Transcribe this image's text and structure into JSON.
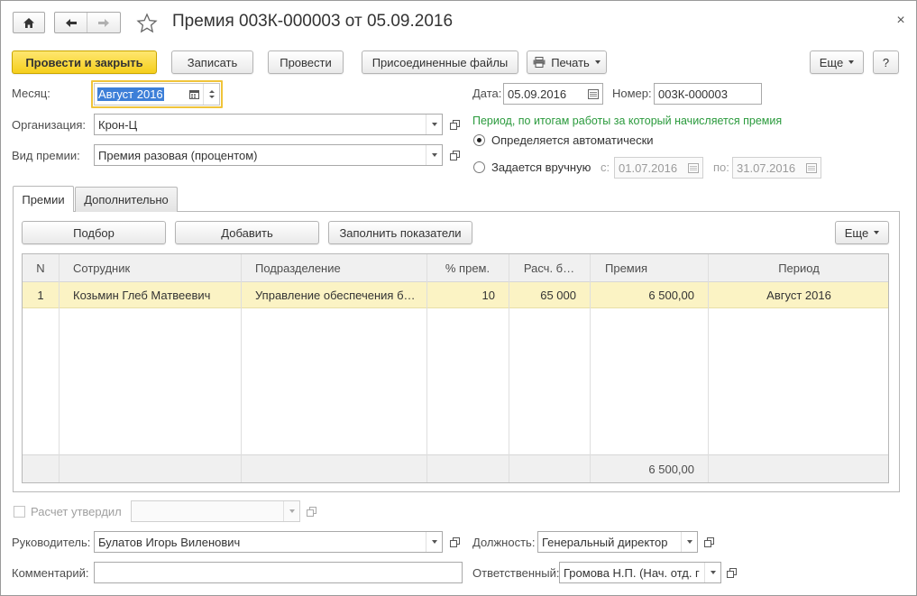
{
  "window": {
    "title": "Премия 003К-000003 от 05.09.2016"
  },
  "toolbar": {
    "post_close": "Провести и закрыть",
    "save": "Записать",
    "post": "Провести",
    "attached_files": "Присоединенные файлы",
    "print": "Печать",
    "more": "Еще",
    "help": "?"
  },
  "form": {
    "month_label": "Месяц:",
    "month_value": "Август 2016",
    "date_label": "Дата:",
    "date_value": "05.09.2016",
    "number_label": "Номер:",
    "number_value": "003К-000003",
    "org_label": "Организация:",
    "org_value": "Крон-Ц",
    "bonus_type_label": "Вид премии:",
    "bonus_type_value": "Премия разовая (процентом)",
    "period_hint": "Период, по итогам работы за который начисляется премия",
    "radio_auto": "Определяется автоматически",
    "radio_manual": "Задается вручную",
    "from_label": "с:",
    "from_value": "01.07.2016",
    "to_label": "по:",
    "to_value": "31.07.2016"
  },
  "tabs": [
    {
      "label": "Премии",
      "active": true
    },
    {
      "label": "Дополнительно",
      "active": false
    }
  ],
  "table_toolbar": {
    "pick": "Подбор",
    "add": "Добавить",
    "fill": "Заполнить показатели",
    "more": "Еще"
  },
  "table": {
    "columns": [
      "N",
      "Сотрудник",
      "Подразделение",
      "% прем.",
      "Расч. б…",
      "Премия",
      "Период"
    ],
    "rows": [
      {
        "n": "1",
        "employee": "Козьмин Глеб Матвеевич",
        "department": "Управление обеспечения б…",
        "percent": "10",
        "base": "65 000",
        "bonus": "6 500,00",
        "period": "Август 2016"
      }
    ],
    "total_bonus": "6 500,00"
  },
  "footer": {
    "approved_label": "Расчет утвердил",
    "head_label": "Руководитель:",
    "head_value": "Булатов Игорь Виленович",
    "position_label": "Должность:",
    "position_value": "Генеральный директор",
    "comment_label": "Комментарий:",
    "comment_value": "",
    "responsible_label": "Ответственный:",
    "responsible_value": "Громова Н.П. (Нач. отд. г"
  }
}
